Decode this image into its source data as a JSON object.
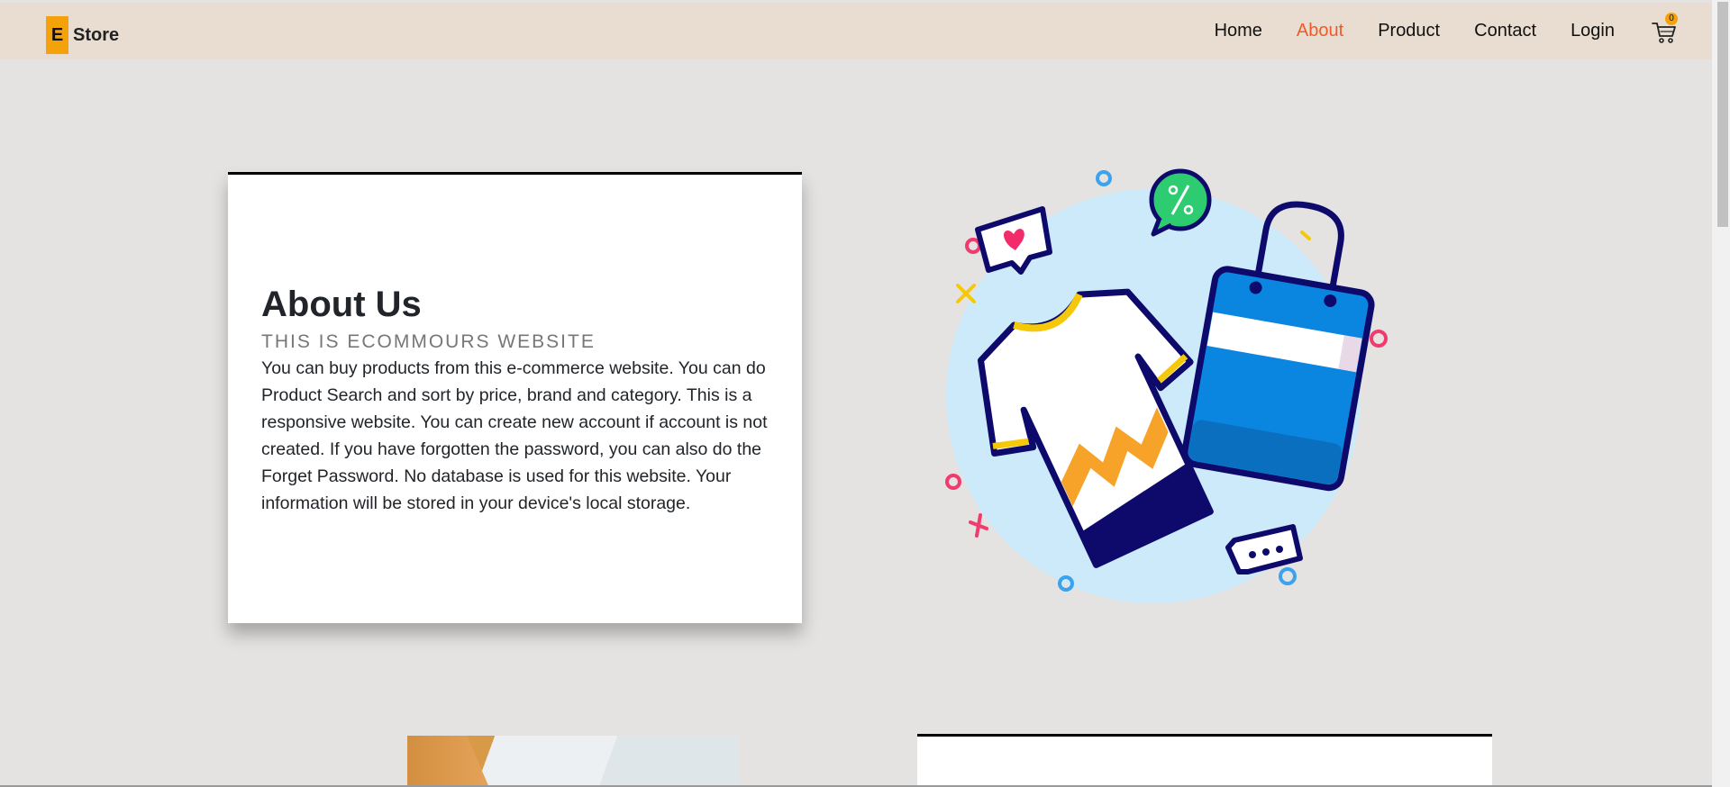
{
  "brand": {
    "badge": "E",
    "name": "Store",
    "badge_color": "#f5a20a"
  },
  "nav": {
    "links": [
      {
        "label": "Home",
        "active": false
      },
      {
        "label": "About",
        "active": true
      },
      {
        "label": "Product",
        "active": false
      },
      {
        "label": "Contact",
        "active": false
      },
      {
        "label": "Login",
        "active": false
      }
    ],
    "active_color": "#f05a28",
    "cart": {
      "icon": "cart-icon",
      "count": "0"
    }
  },
  "about": {
    "title": "About Us",
    "subtitle": "THIS IS ECOMMOURS WEBSITE",
    "body": "You can buy products from this e-commerce website. You can do Product Search and sort by price, brand and category. This is a responsive website. You can create new account if account is not created. If you have forgotten the password, you can also do the Forget Password. No database is used for this website. Your information will be stored in your device's local storage."
  },
  "hero_illustration": {
    "icon": "shopping-illustration"
  },
  "colors": {
    "navbar_bg": "#e8ddd0",
    "page_bg": "#e5e3e2"
  }
}
